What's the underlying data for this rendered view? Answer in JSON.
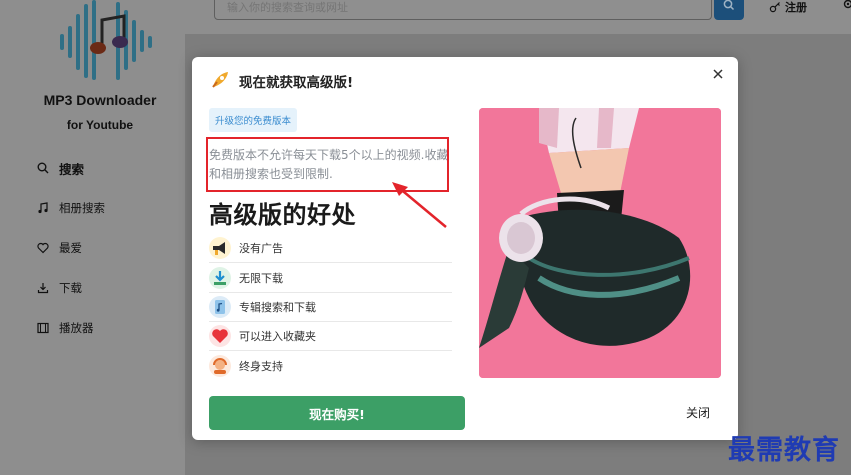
{
  "app": {
    "name": "MP3 Downloader",
    "subtitle": "for Youtube"
  },
  "sidebar": {
    "items": [
      {
        "label": "搜索",
        "icon": "search-icon",
        "active": true
      },
      {
        "label": "相册搜索",
        "icon": "music-note-icon",
        "active": false
      },
      {
        "label": "最爱",
        "icon": "heart-icon",
        "active": false
      },
      {
        "label": "下载",
        "icon": "download-icon",
        "active": false
      },
      {
        "label": "播放器",
        "icon": "film-icon",
        "active": false
      }
    ]
  },
  "topbar": {
    "search_placeholder": "输入你的搜索查询或网址",
    "register_label": "注册"
  },
  "modal": {
    "title": "现在就获取高级版!",
    "upgrade_tag": "升级您的免费版本",
    "description": "免费版本不允许每天下载5个以上的视频.收藏和相册搜索也受到限制.",
    "benefits_title": "高级版的好处",
    "benefits": [
      {
        "label": "没有广告",
        "icon": "megaphone-icon"
      },
      {
        "label": "无限下载",
        "icon": "download-arrow-icon"
      },
      {
        "label": "专辑搜索和下载",
        "icon": "music-file-icon"
      },
      {
        "label": "可以进入收藏夹",
        "icon": "heart-icon"
      },
      {
        "label": "终身支持",
        "icon": "support-person-icon"
      }
    ],
    "buy_label": "现在购买!",
    "close_label": "关闭"
  },
  "watermark": "最需教育",
  "colors": {
    "accent_green": "#3c9f66",
    "tag_blue": "#3a8ccf",
    "highlight_red": "#e3242b",
    "photo_pink": "#f2769a",
    "watermark_blue": "#1f3bb3"
  }
}
